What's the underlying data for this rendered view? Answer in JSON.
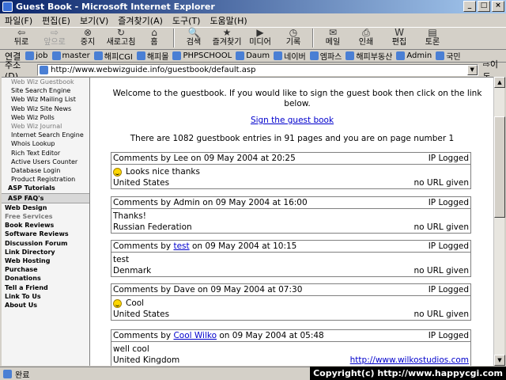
{
  "window": {
    "title": "Guest Book - Microsoft Internet Explorer",
    "btn_min": "_",
    "btn_max": "□",
    "btn_close": "×"
  },
  "menu": [
    "파일(F)",
    "편집(E)",
    "보기(V)",
    "즐겨찾기(A)",
    "도구(T)",
    "도움말(H)"
  ],
  "toolbar": {
    "back": "뒤로",
    "forward": "앞으로",
    "stop": "중지",
    "refresh": "새로고침",
    "home": "홈",
    "search": "검색",
    "favorites": "즐겨찾기",
    "media": "미디어",
    "history": "기록",
    "mail": "메일",
    "print": "인쇄",
    "edit": "편집",
    "discuss": "토론"
  },
  "links": {
    "label": "연결",
    "items": [
      "job",
      "master",
      "해피CGI",
      "해피몰",
      "PHPSCHOOL",
      "Daum",
      "네이버",
      "엠파스",
      "해피부동산",
      "Admin",
      "국민"
    ]
  },
  "address": {
    "label": "주소(D)",
    "url": "http://www.webwizguide.info/guestbook/default.asp",
    "go": "이동"
  },
  "leftnav": {
    "top_cut": "Web Wiz Guestbook",
    "subs": [
      "Site Search Engine",
      "Web Wiz Mailing List",
      "Web Wiz Site News",
      "Web Wiz Polls",
      "Web Wiz Journal",
      "Internet Search Engine",
      "Whois Lookup",
      "Rich Text Editor",
      "Active Users Counter",
      "Database Login",
      "Product Registration"
    ],
    "sections": [
      "ASP Tutorials",
      "ASP FAQ's"
    ],
    "main": [
      "Web Design",
      "Free Services",
      "Book Reviews",
      "Software Reviews",
      "Discussion Forum",
      "Link Directory",
      "Web Hosting",
      "Purchase",
      "Donations",
      "Tell a Friend",
      "Link To Us",
      "About Us"
    ]
  },
  "content": {
    "welcome": "Welcome to the guestbook. If you would like to sign the guest book then click on the link below.",
    "sign_link": "Sign the guest book",
    "stats": "There are 1082 guestbook entries in 91 pages and you are on page number 1"
  },
  "entries": [
    {
      "prefix": "Comments by ",
      "name": "Lee",
      "date": " on 09 May 2004 at 20:25",
      "ip": "IP Logged",
      "comment": "Looks nice thanks",
      "smiley": true,
      "country": "United States",
      "url": "no URL given"
    },
    {
      "prefix": "Comments by ",
      "name": "Admin",
      "date": " on 09 May 2004 at 16:00",
      "ip": "IP Logged",
      "comment": "Thanks!",
      "smiley": false,
      "country": "Russian Federation",
      "url": "no URL given"
    },
    {
      "prefix": "Comments by ",
      "name": "test",
      "date": " on 09 May 2004 at 10:15",
      "ip": "IP Logged",
      "comment": "test",
      "smiley": false,
      "country": "Denmark",
      "url": "no URL given",
      "name_link": true
    },
    {
      "prefix": "Comments by ",
      "name": "Dave",
      "date": " on 09 May 2004 at 07:30",
      "ip": "IP Logged",
      "comment": "Cool",
      "smiley": true,
      "country": "United States",
      "url": "no URL given"
    },
    {
      "prefix": "Comments by ",
      "name": "Cool Wilko",
      "date": " on 09 May 2004 at 05:48",
      "ip": "IP Logged",
      "comment": "well cool",
      "smiley": false,
      "country": "United Kingdom",
      "url": "http://www.wilkostudios.com",
      "name_link": true,
      "url_link": true
    }
  ],
  "status": {
    "text": "완료",
    "copyright": "Copyright(c) http://www.happycgi.com"
  }
}
